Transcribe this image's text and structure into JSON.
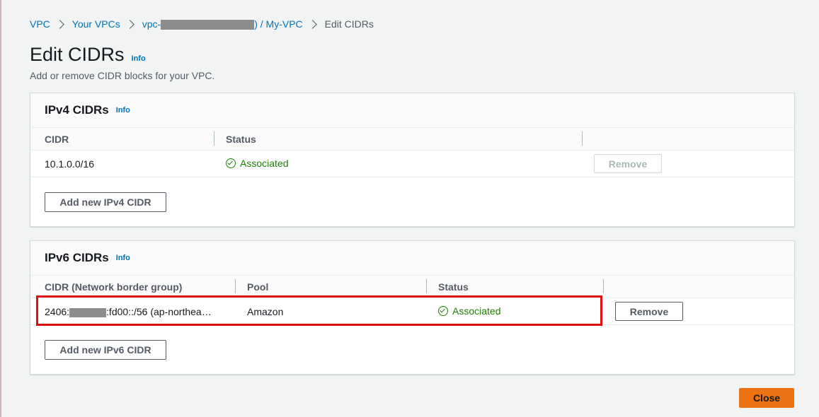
{
  "breadcrumb": {
    "vpc": "VPC",
    "your_vpcs": "Your VPCs",
    "vpc_id_prefix": "vpc-",
    "vpc_id_suffix": ") / My-VPC",
    "current": "Edit CIDRs"
  },
  "page": {
    "title": "Edit CIDRs",
    "info": "Info",
    "description": "Add or remove CIDR blocks for your VPC."
  },
  "ipv4": {
    "title": "IPv4 CIDRs",
    "info": "Info",
    "columns": [
      "CIDR",
      "Status"
    ],
    "rows": [
      {
        "cidr": "10.1.0.0/16",
        "status": "Associated",
        "remove_label": "Remove",
        "remove_disabled": true
      }
    ],
    "add_button": "Add new IPv4 CIDR"
  },
  "ipv6": {
    "title": "IPv6 CIDRs",
    "info": "Info",
    "columns": [
      "CIDR (Network border group)",
      "Pool",
      "Status"
    ],
    "rows": [
      {
        "cidr_prefix": "2406:",
        "cidr_suffix": ":fd00::/56 (ap-northea…",
        "pool": "Amazon",
        "status": "Associated",
        "remove_label": "Remove",
        "remove_disabled": false
      }
    ],
    "add_button": "Add new IPv6 CIDR"
  },
  "footer": {
    "close_button": "Close"
  },
  "colors": {
    "link": "#0073bb",
    "success": "#1d8102",
    "primary": "#ec7211",
    "highlight": "#e01010"
  }
}
